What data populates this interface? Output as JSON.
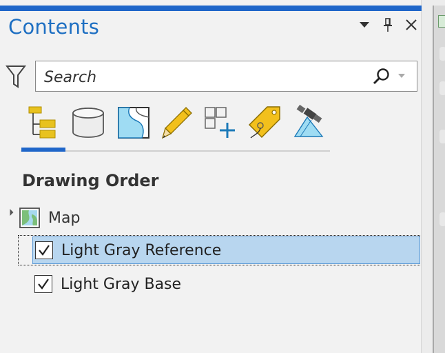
{
  "pane": {
    "title": "Contents",
    "controls": [
      "dropdown-icon",
      "pin-icon",
      "close-icon"
    ]
  },
  "search": {
    "placeholder": "Search"
  },
  "tabs": [
    {
      "icon": "list-by-drawing-order-icon",
      "active": true
    },
    {
      "icon": "list-by-data-source-icon",
      "active": false
    },
    {
      "icon": "list-by-selection-icon",
      "active": false
    },
    {
      "icon": "list-by-editing-icon",
      "active": false
    },
    {
      "icon": "list-by-snapping-icon",
      "active": false
    },
    {
      "icon": "list-by-labeling-icon",
      "active": false
    },
    {
      "icon": "list-by-perspective-imagery-icon",
      "active": false
    }
  ],
  "section": {
    "title": "Drawing Order"
  },
  "tree": {
    "map": {
      "label": "Map",
      "expanded": true
    },
    "layers": [
      {
        "label": "Light Gray Reference",
        "checked": true,
        "selected": true
      },
      {
        "label": "Light Gray Base",
        "checked": true,
        "selected": false
      }
    ]
  },
  "colors": {
    "accent": "#1f66c9",
    "title": "#1e6fc2",
    "selection": "#b8d6ef"
  }
}
